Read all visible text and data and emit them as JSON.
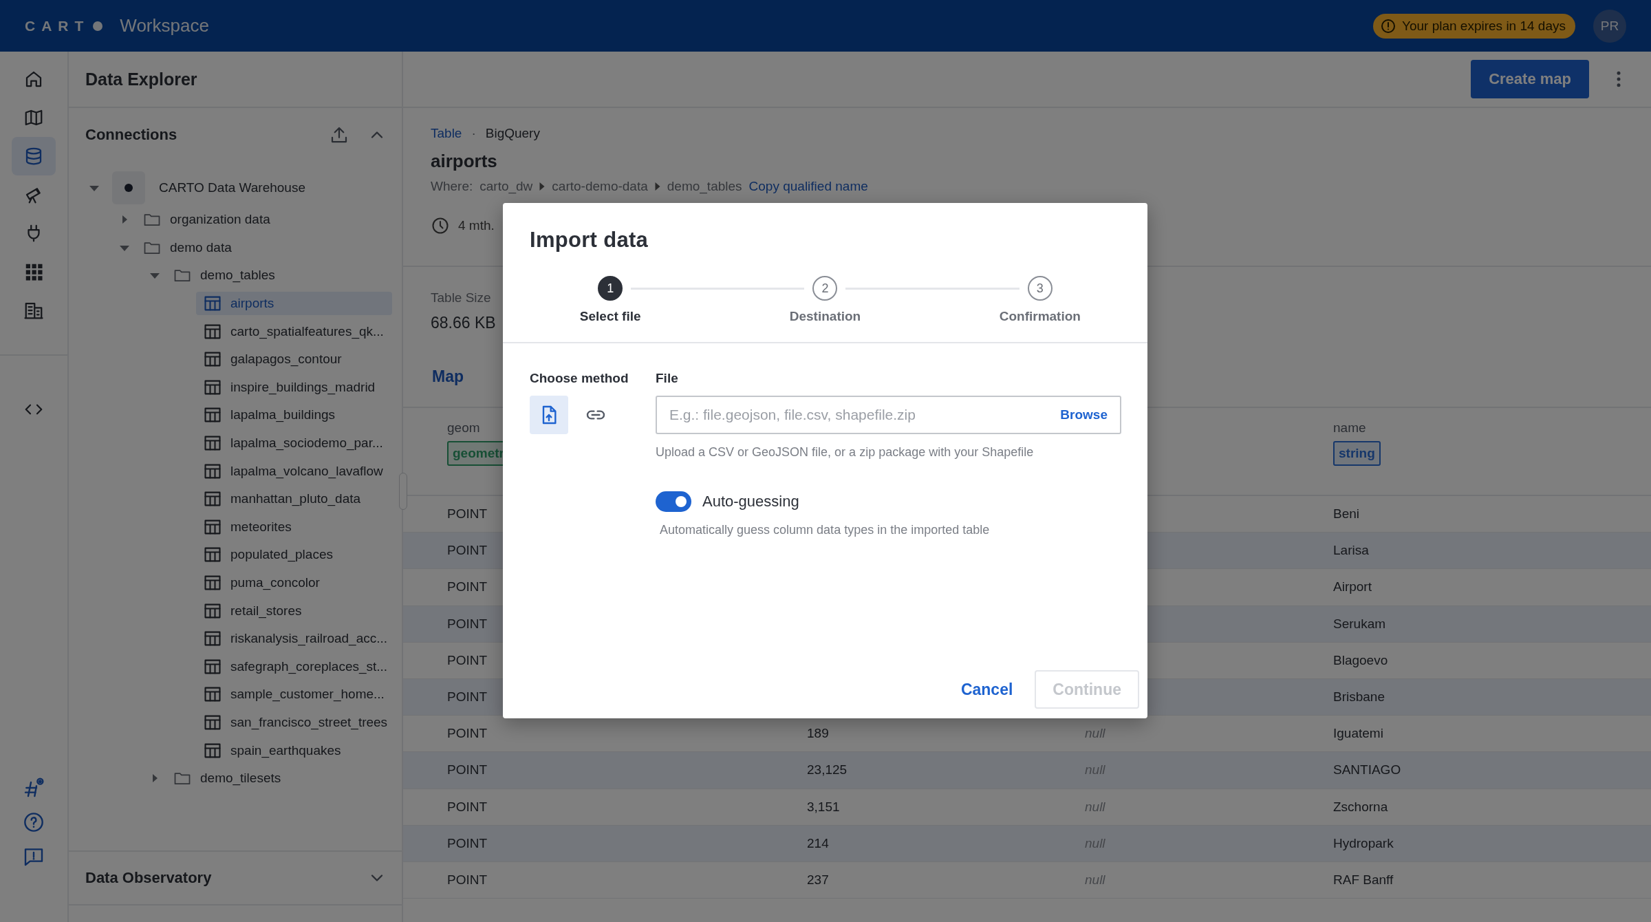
{
  "top_bar": {
    "logo_text": "CART",
    "product": "Workspace",
    "plan_badge": "Your plan expires in 14 days",
    "avatar": "PR"
  },
  "nav_rail": {
    "top_items": [
      {
        "kind": "home",
        "selected": false
      },
      {
        "kind": "maps",
        "selected": false
      },
      {
        "kind": "data",
        "selected": true
      },
      {
        "kind": "explore",
        "selected": false
      },
      {
        "kind": "connections",
        "selected": false
      },
      {
        "kind": "apps",
        "selected": false
      },
      {
        "kind": "organization",
        "selected": false
      }
    ],
    "middle_items": [
      {
        "kind": "developers"
      }
    ],
    "bottom_items": [
      {
        "kind": "whats-new"
      },
      {
        "kind": "help"
      },
      {
        "kind": "feedback"
      }
    ]
  },
  "explorer": {
    "title": "Data Explorer",
    "connections": {
      "title": "Connections",
      "expanded": true,
      "tree": [
        {
          "label": "CARTO Data Warehouse",
          "kind": "connection",
          "expanded": true,
          "children": [
            {
              "label": "organization data",
              "kind": "folder",
              "expanded": false
            },
            {
              "label": "demo data",
              "kind": "folder",
              "expanded": true,
              "children": [
                {
                  "label": "demo_tables",
                  "kind": "folder",
                  "expanded": true,
                  "children": [
                    {
                      "label": "airports",
                      "kind": "table",
                      "selected": true
                    },
                    {
                      "label": "carto_spatialfeatures_qk...",
                      "kind": "table",
                      "selected": false
                    },
                    {
                      "label": "galapagos_contour",
                      "kind": "table",
                      "selected": false
                    },
                    {
                      "label": "inspire_buildings_madrid",
                      "kind": "table",
                      "selected": false
                    },
                    {
                      "label": "lapalma_buildings",
                      "kind": "table",
                      "selected": false
                    },
                    {
                      "label": "lapalma_sociodemo_par...",
                      "kind": "table",
                      "selected": false
                    },
                    {
                      "label": "lapalma_volcano_lavaflow",
                      "kind": "table",
                      "selected": false
                    },
                    {
                      "label": "manhattan_pluto_data",
                      "kind": "table",
                      "selected": false
                    },
                    {
                      "label": "meteorites",
                      "kind": "table",
                      "selected": false
                    },
                    {
                      "label": "populated_places",
                      "kind": "table",
                      "selected": false
                    },
                    {
                      "label": "puma_concolor",
                      "kind": "table",
                      "selected": false
                    },
                    {
                      "label": "retail_stores",
                      "kind": "table",
                      "selected": false
                    },
                    {
                      "label": "riskanalysis_railroad_acc...",
                      "kind": "table",
                      "selected": false
                    },
                    {
                      "label": "safegraph_coreplaces_st...",
                      "kind": "table",
                      "selected": false
                    },
                    {
                      "label": "sample_customer_home...",
                      "kind": "table",
                      "selected": false
                    },
                    {
                      "label": "san_francisco_street_trees",
                      "kind": "table",
                      "selected": false
                    },
                    {
                      "label": "spain_earthquakes",
                      "kind": "table",
                      "selected": false
                    }
                  ]
                },
                {
                  "label": "demo_tilesets",
                  "kind": "folder",
                  "expanded": false
                }
              ]
            }
          ]
        }
      ]
    },
    "data_observatory": {
      "title": "Data Observatory",
      "expanded": false
    }
  },
  "main": {
    "create_map": "Create map",
    "breadcrumb": {
      "type": "Table",
      "separator": "·",
      "source": "BigQuery"
    },
    "title": "airports",
    "where": {
      "label": "Where:",
      "path": [
        "carto_dw",
        "carto-demo-data",
        "demo_tables"
      ],
      "copy_link": "Copy qualified name"
    },
    "updated": "4 mth.",
    "stats": [
      {
        "label": "Table Size",
        "value": "68.66 KB"
      }
    ],
    "tabs": [
      {
        "label": "Map",
        "selected": true
      }
    ],
    "table": {
      "columns": [
        {
          "header": "geom",
          "type": "geometr",
          "kind": "geometry"
        },
        {
          "header": "name",
          "type": "string",
          "kind": "string"
        }
      ],
      "rows": [
        {
          "geom": "POINT",
          "name": "Beni"
        },
        {
          "geom": "POINT",
          "name": "Larisa"
        },
        {
          "geom": "POINT",
          "name": "Airport"
        },
        {
          "geom": "POINT",
          "name": "Serukam"
        },
        {
          "geom": "POINT",
          "name": "Blagoevo"
        },
        {
          "geom": "POINT",
          "name": "Brisbane"
        },
        {
          "geom": "POINT",
          "column_2": "189",
          "column_3": "null",
          "name": "Iguatemi"
        },
        {
          "geom": "POINT",
          "column_2": "23,125",
          "column_3": "null",
          "name": "SANTIAGO"
        },
        {
          "geom": "POINT",
          "column_2": "3,151",
          "column_3": "null",
          "name": "Zschorna"
        },
        {
          "geom": "POINT",
          "column_2": "214",
          "column_3": "null",
          "name": "Hydropark"
        },
        {
          "geom": "POINT",
          "column_2": "237",
          "column_3": "null",
          "name": "RAF Banff"
        }
      ]
    }
  },
  "dialog": {
    "title": "Import data",
    "steps": [
      {
        "number": "1",
        "label": "Select file",
        "active": true
      },
      {
        "number": "2",
        "label": "Destination",
        "active": false
      },
      {
        "number": "3",
        "label": "Confirmation",
        "active": false
      }
    ],
    "method_label": "Choose method",
    "methods": [
      {
        "kind": "upload",
        "selected": true
      },
      {
        "kind": "link",
        "selected": false
      }
    ],
    "file": {
      "label": "File",
      "placeholder": "E.g.: file.geojson, file.csv, shapefile.zip",
      "browse": "Browse",
      "help": "Upload a CSV or GeoJSON file, or a zip package with your Shapefile"
    },
    "auto_guessing": {
      "label": "Auto-guessing",
      "on": true,
      "description": "Automatically guess column data types in the imported table"
    },
    "cancel": "Cancel",
    "continue": {
      "label": "Continue",
      "disabled": true
    }
  }
}
